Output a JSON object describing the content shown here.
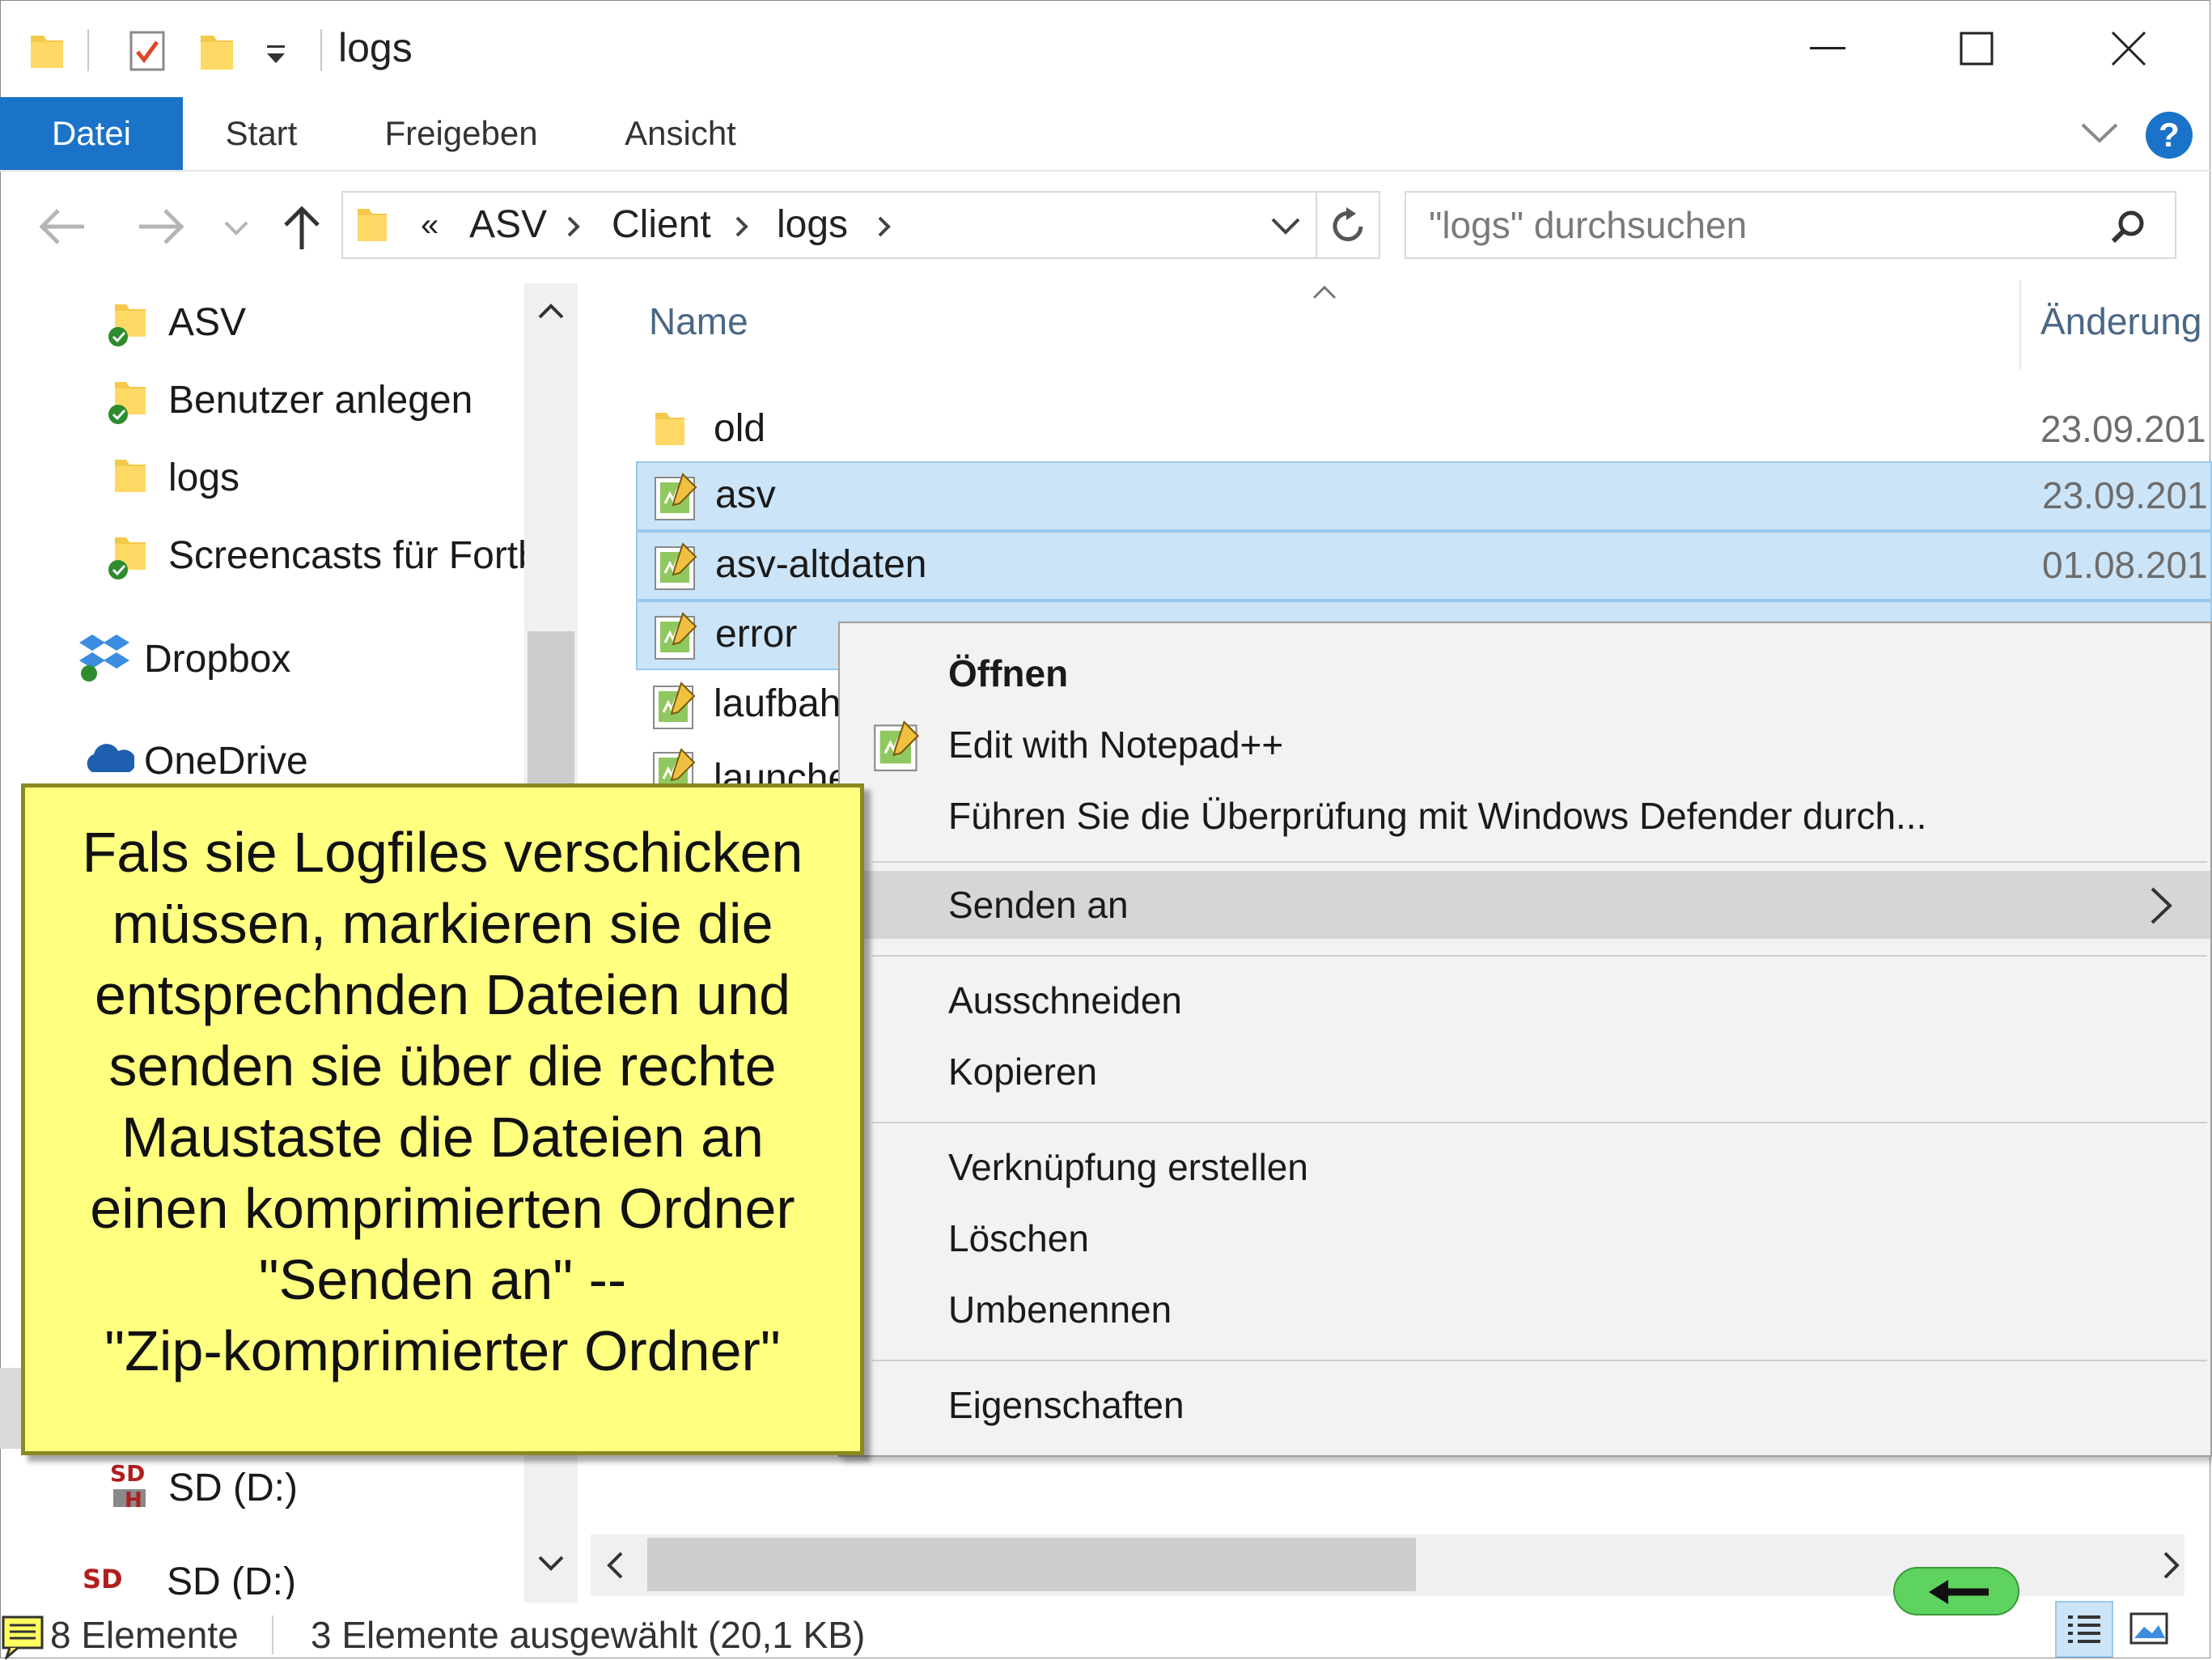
{
  "window": {
    "title": "logs"
  },
  "ribbon": {
    "tabs": [
      {
        "label": "Datei",
        "active": true
      },
      {
        "label": "Start",
        "active": false
      },
      {
        "label": "Freigeben",
        "active": false
      },
      {
        "label": "Ansicht",
        "active": false
      }
    ],
    "help": "?"
  },
  "address": {
    "overflow": "«",
    "crumbs": [
      "ASV",
      "Client",
      "logs"
    ],
    "search_placeholder": "\"logs\" durchsuchen"
  },
  "nav": {
    "items": [
      {
        "label": "ASV",
        "icon": "folder-icon"
      },
      {
        "label": "Benutzer anlegen",
        "icon": "folder-icon"
      },
      {
        "label": "logs",
        "icon": "folder-icon"
      },
      {
        "label": "Screencasts für Fortb",
        "icon": "folder-icon"
      },
      {
        "label": "Dropbox",
        "icon": "dropbox-icon"
      },
      {
        "label": "OneDrive",
        "icon": "onedrive-icon"
      },
      {
        "label": "SD (D:)",
        "icon": "sd-drive-icon"
      },
      {
        "label": "SD (D:)",
        "icon": "sd-drive-icon"
      }
    ]
  },
  "filelist": {
    "columns": [
      "Name",
      "Änderung"
    ],
    "rows": [
      {
        "name": "old",
        "date": "23.09.201",
        "type": "folder",
        "selected": false
      },
      {
        "name": "asv",
        "date": "23.09.201",
        "type": "log",
        "selected": true
      },
      {
        "name": "asv-altdaten",
        "date": "01.08.201",
        "type": "log",
        "selected": true
      },
      {
        "name": "error",
        "date": "",
        "type": "log",
        "selected": true
      },
      {
        "name": "laufbah",
        "date": "",
        "type": "log",
        "selected": false
      },
      {
        "name": "launche",
        "date": "",
        "type": "log",
        "selected": false
      }
    ]
  },
  "context_menu": {
    "items": [
      "Öffnen",
      "Edit with Notepad++",
      "Führen Sie die Überprüfung mit Windows Defender durch...",
      "Senden an",
      "Ausschneiden",
      "Kopieren",
      "Verknüpfung erstellen",
      "Löschen",
      "Umbenennen",
      "Eigenschaften"
    ]
  },
  "note": {
    "text": "Fals sie Logfiles verschicken\nmüssen, markieren sie die\nentsprechnden Dateien und\nsenden sie über die rechte\nMaustaste die Dateien an\neinen komprimierten Ordner\n\"Senden an\" --\n\"Zip-komprimierter Ordner\""
  },
  "status": {
    "count": "8 Elemente",
    "selection": "3 Elemente ausgewählt (20,1 KB)"
  },
  "colors": {
    "accent": "#1a73c8",
    "selection": "#cce4f7",
    "note": "#ffff80",
    "menu": "#f2f2f2"
  }
}
